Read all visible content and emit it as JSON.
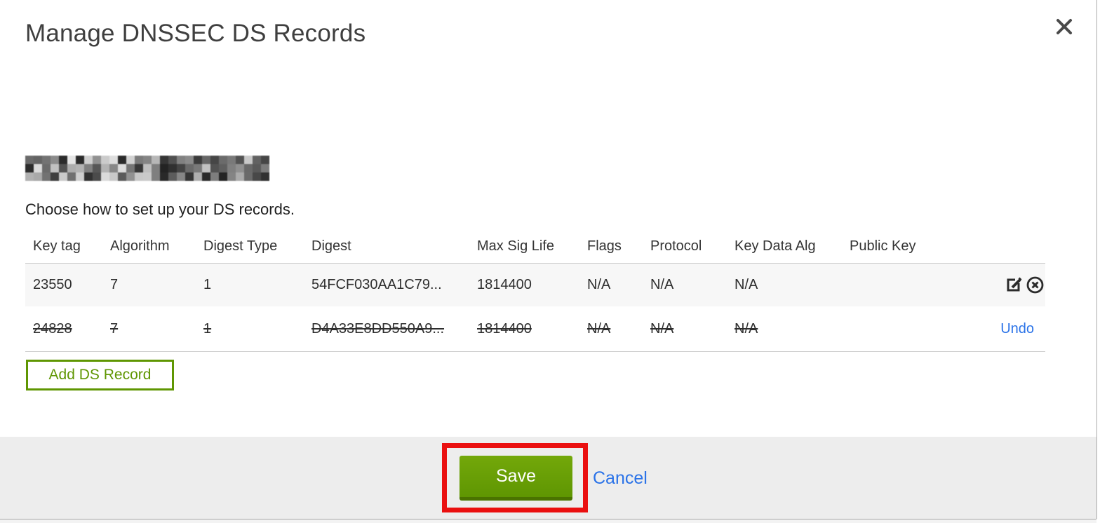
{
  "modal": {
    "title": "Manage DNSSEC DS Records",
    "instruction": "Choose how to set up your DS records.",
    "domain_redacted": true
  },
  "table": {
    "columns": [
      "Key tag",
      "Algorithm",
      "Digest Type",
      "Digest",
      "Max Sig Life",
      "Flags",
      "Protocol",
      "Key Data Alg",
      "Public Key"
    ],
    "rows": [
      {
        "key_tag": "23550",
        "algorithm": "7",
        "digest_type": "1",
        "digest": "54FCF030AA1C79...",
        "max_sig_life": "1814400",
        "flags": "N/A",
        "protocol": "N/A",
        "key_data_alg": "N/A",
        "public_key": "",
        "state": "normal"
      },
      {
        "key_tag": "24828",
        "algorithm": "7",
        "digest_type": "1",
        "digest": "D4A33E8DD550A9...",
        "max_sig_life": "1814400",
        "flags": "N/A",
        "protocol": "N/A",
        "key_data_alg": "N/A",
        "public_key": "",
        "state": "deleted",
        "undo_label": "Undo"
      }
    ]
  },
  "buttons": {
    "add_ds_record": "Add DS Record",
    "save": "Save",
    "cancel": "Cancel"
  },
  "icons": {
    "close": "close-x-icon",
    "edit": "edit-pencil-square-icon",
    "delete": "circle-x-icon"
  },
  "annotation": {
    "shape": "red-rectangle-highlight",
    "target": "save-button"
  },
  "colors": {
    "green": "#5f9602",
    "green_light": "#73a80a",
    "green_dark": "#4a7300",
    "link_blue": "#2b73e8",
    "annotation_red": "#ea1010",
    "row_alt_bg": "#f7f7f7",
    "footer_bg": "#ededed"
  }
}
